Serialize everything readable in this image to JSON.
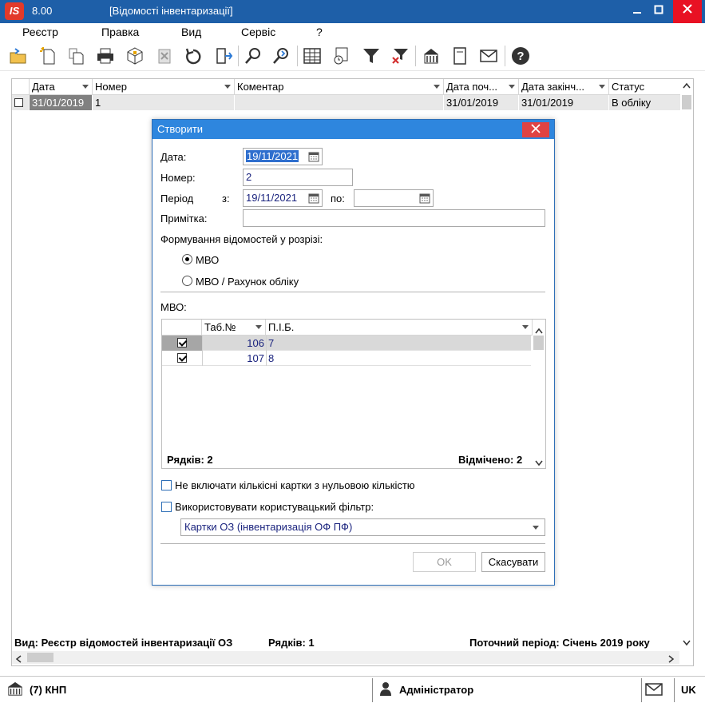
{
  "app": {
    "logo": "IS",
    "version": "8.00",
    "window_title": "[Відомості інвентаризації]"
  },
  "menu": [
    "Реєстр",
    "Правка",
    "Вид",
    "Сервіс",
    "?"
  ],
  "toolbar_icons": [
    "open-folder-icon",
    "new-document-icon",
    "copy-document-icon",
    "print-icon",
    "package-icon",
    "delete-icon",
    "refresh-icon",
    "exit-icon",
    "search-icon",
    "find-next-icon",
    "grid-icon",
    "calendar-clock-icon",
    "filter-icon",
    "clear-filter-icon",
    "building-icon",
    "document-icon",
    "mail-icon",
    "help-icon"
  ],
  "grid": {
    "columns": [
      "Дата",
      "Номер",
      "Коментар",
      "Дата поч...",
      "Дата закінч...",
      "Статус"
    ],
    "rows": [
      {
        "date": "31/01/2019",
        "number": "1",
        "comment": "",
        "date_start": "31/01/2019",
        "date_end": "31/01/2019",
        "status": "В обліку"
      }
    ]
  },
  "status_line": {
    "view": "Вид: Реєстр відомостей інвентаризації ОЗ",
    "rows": "Рядків: 1",
    "period": "Поточний період: Січень 2019 року"
  },
  "bottombar": {
    "company": "(7) КНП",
    "user": "Адміністратор",
    "lang": "UK"
  },
  "dialog": {
    "title": "Створити",
    "date_label": "Дата:",
    "date_value": "19/11/2021",
    "number_label": "Номер:",
    "number_value": "2",
    "period_label": "Період",
    "from_label": "з:",
    "period_from": "19/11/2021",
    "to_label": "по:",
    "period_to": "",
    "note_label": "Примітка:",
    "note_value": "",
    "grouping_label": "Формування відомостей у розрізі:",
    "radio_mvo": "МВО",
    "radio_mvo_account": "МВО / Рахунок обліку",
    "mvo_label": "МВО:",
    "sub_columns": [
      "Таб.№",
      "П.І.Б."
    ],
    "sub_rows": [
      {
        "tab": "106",
        "name": "7",
        "checked": true
      },
      {
        "tab": "107",
        "name": "8",
        "checked": true
      }
    ],
    "rows_count": "Рядків: 2",
    "marked_count": "Відмічено: 2",
    "exclude_zero_label": "Не включати кількісні картки з нульовою кількістю",
    "use_filter_label": "Використовувати користувацький фільтр:",
    "filter_value": "Картки ОЗ (інвентаризація ОФ ПФ)",
    "ok_label": "OK",
    "cancel_label": "Скасувати"
  }
}
